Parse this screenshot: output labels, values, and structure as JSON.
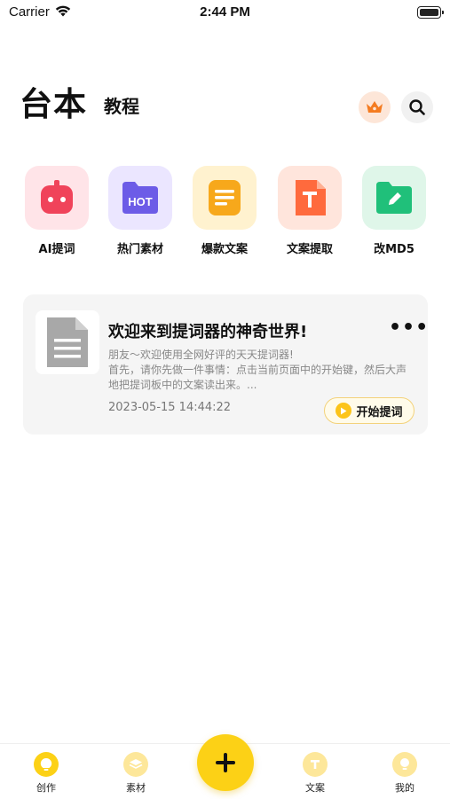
{
  "status_bar": {
    "carrier": "Carrier",
    "time": "2:44 PM"
  },
  "header": {
    "active_tab": "台本",
    "other_tab": "教程"
  },
  "shortcuts": [
    {
      "label": "AI提词",
      "icon": "robot-icon",
      "color": "#f0435a"
    },
    {
      "label": "热门素材",
      "icon": "hot-folder-icon",
      "color": "#6c5ce7"
    },
    {
      "label": "爆款文案",
      "icon": "document-icon",
      "color": "#f7a81b"
    },
    {
      "label": "文案提取",
      "icon": "text-extract-icon",
      "color": "#ff6a3d"
    },
    {
      "label": "改MD5",
      "icon": "edit-folder-icon",
      "color": "#20c07a"
    }
  ],
  "script_card": {
    "title": "欢迎来到提词器的神奇世界!",
    "desc_line1": "朋友～欢迎使用全网好评的天天提词器!",
    "desc_line2": "首先，请你先做一件事情：点击当前页面中的开始键，然后大声地把提词板中的文案读出来。...",
    "date": "2023-05-15 14:44:22",
    "start_label": "开始提词",
    "more": "•••"
  },
  "bottom_nav": {
    "items": [
      {
        "label": "创作",
        "icon": "bulb-icon"
      },
      {
        "label": "素材",
        "icon": "layers-icon"
      },
      {
        "label": "文案",
        "icon": "text-icon"
      },
      {
        "label": "我的",
        "icon": "profile-icon"
      }
    ],
    "fab_icon": "plus-icon",
    "accent": "#fcd116"
  }
}
